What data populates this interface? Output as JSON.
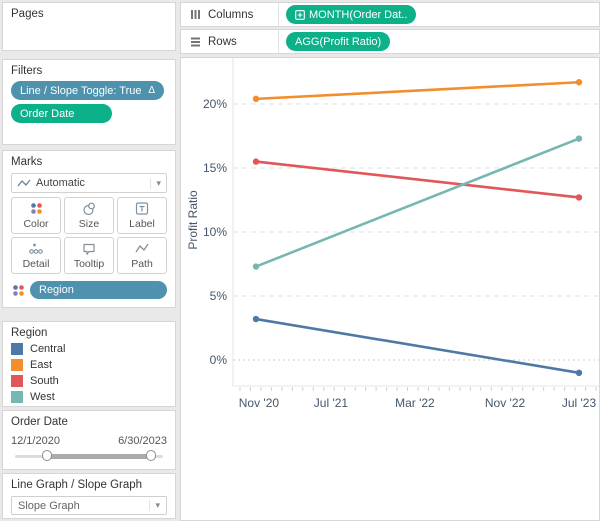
{
  "colors": {
    "pill_green": "#0db189",
    "pill_blue": "#4e92ad"
  },
  "shelves": {
    "columns": {
      "label": "Columns",
      "pill": "MONTH(Order Dat.."
    },
    "rows": {
      "label": "Rows",
      "pill": "AGG(Profit Ratio)"
    }
  },
  "pages": {
    "title": "Pages"
  },
  "filters": {
    "title": "Filters",
    "pills": [
      {
        "label": "Line / Slope Toggle: True",
        "badge": "Δ"
      },
      {
        "label": "Order Date",
        "badge": ""
      }
    ]
  },
  "marks": {
    "title": "Marks",
    "mark_type": "Automatic",
    "buttons": [
      {
        "label": "Color"
      },
      {
        "label": "Size"
      },
      {
        "label": "Label"
      },
      {
        "label": "Detail"
      },
      {
        "label": "Tooltip"
      },
      {
        "label": "Path"
      }
    ],
    "encoding_pill": "Region"
  },
  "legend": {
    "title": "Region",
    "items": [
      {
        "label": "Central",
        "color": "#4e79a7"
      },
      {
        "label": "East",
        "color": "#f28e2b"
      },
      {
        "label": "South",
        "color": "#e15759"
      },
      {
        "label": "West",
        "color": "#76b7b2"
      }
    ]
  },
  "date_filter": {
    "title": "Order Date",
    "start": "12/1/2020",
    "end": "6/30/2023"
  },
  "parameter": {
    "title": "Line Graph / Slope Graph",
    "value": "Slope Graph"
  },
  "chart_data": {
    "type": "line",
    "subtype": "slope",
    "title": "",
    "xlabel": "",
    "ylabel": "Profit Ratio",
    "grid": true,
    "legend_position": "left-panel",
    "ylim": [
      -2,
      23.6
    ],
    "y_ticks": [
      "0%",
      "5%",
      "10%",
      "15%",
      "20%"
    ],
    "x": [
      "Dec '20",
      "Jun '23"
    ],
    "x_tick_labels": [
      "Nov '20",
      "Jul '21",
      "Mar '22",
      "Nov '22",
      "Jul '23"
    ],
    "series": [
      {
        "name": "Central",
        "color": "#4e79a7",
        "values": [
          3.2,
          -1.0
        ]
      },
      {
        "name": "East",
        "color": "#f28e2b",
        "values": [
          20.4,
          21.7
        ]
      },
      {
        "name": "South",
        "color": "#e15759",
        "values": [
          15.5,
          12.7
        ]
      },
      {
        "name": "West",
        "color": "#76b7b2",
        "values": [
          7.3,
          17.3
        ]
      }
    ]
  }
}
